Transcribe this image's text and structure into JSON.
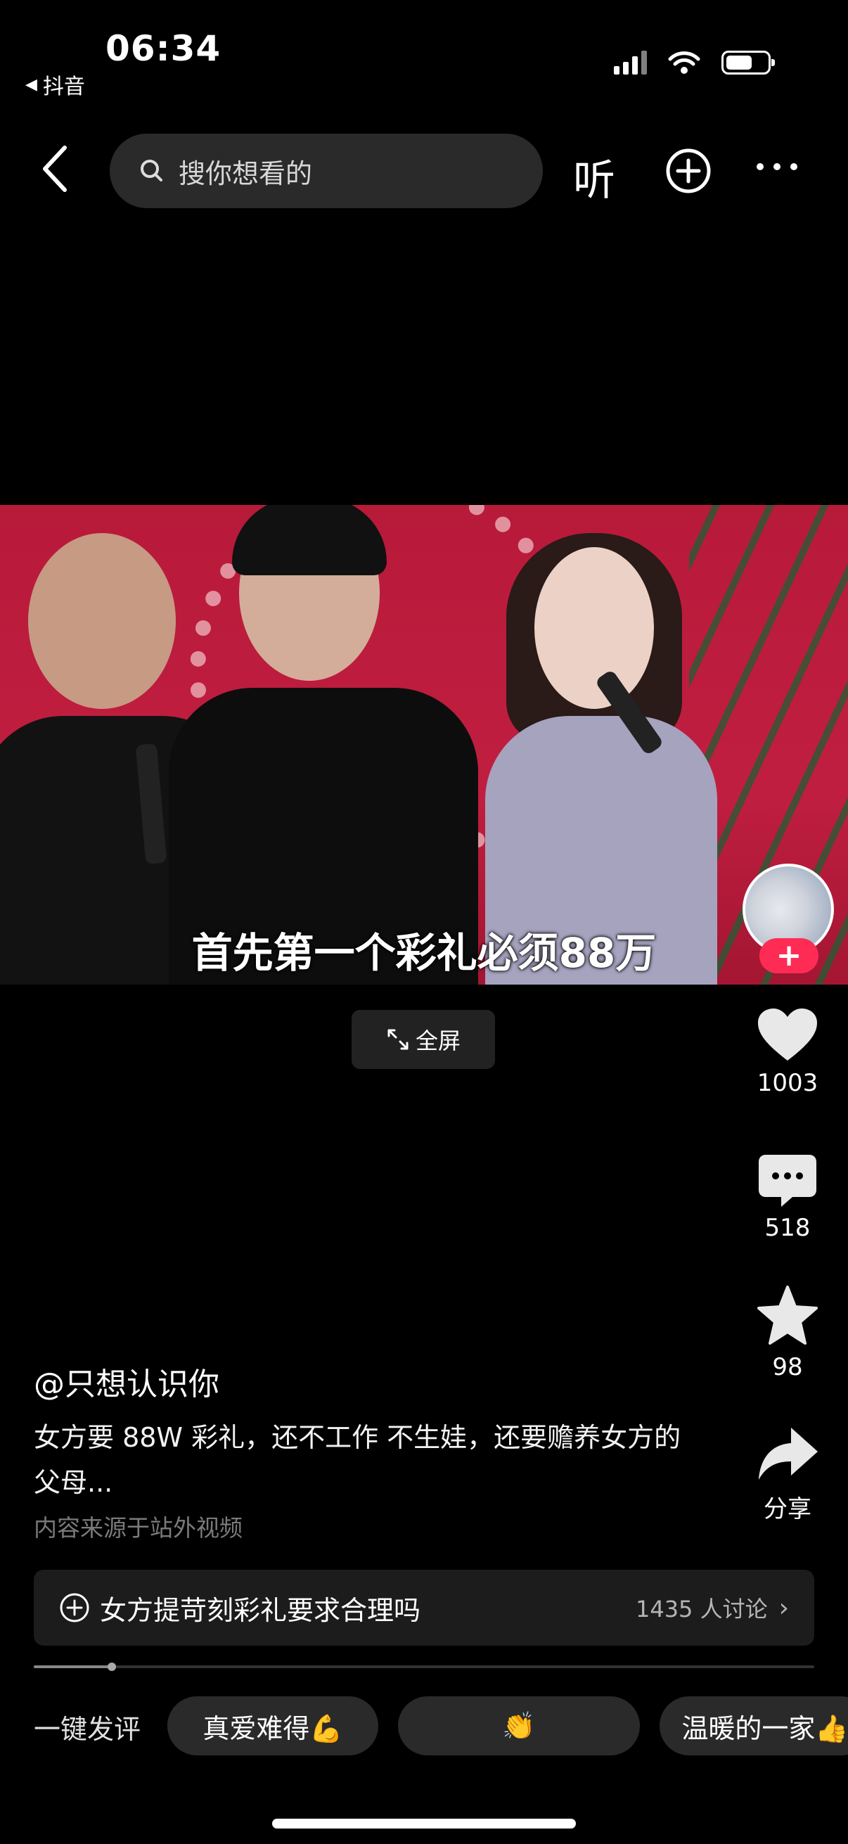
{
  "status_bar": {
    "time": "06:34",
    "back_app": "抖音"
  },
  "top_nav": {
    "search_placeholder": "搜你想看的",
    "listen_label": "听"
  },
  "video": {
    "subtitle": "首先第一个彩礼必须88万",
    "fullscreen_label": "全屏"
  },
  "actions": {
    "likes": "1003",
    "comments": "518",
    "favorites": "98",
    "share_label": "分享"
  },
  "caption": {
    "author": "@只想认识你",
    "description": "女方要 88W 彩礼，还不工作 不生娃，还要赡养女方的父母...",
    "source_note": "内容来源于站外视频"
  },
  "topic": {
    "title": "女方提苛刻彩礼要求合理吗",
    "participants": "1435 人讨论"
  },
  "quick_comment": {
    "label": "一键发评",
    "chips": [
      "真爱难得💪",
      "👏",
      "温暖的一家👍"
    ]
  },
  "progress": 0.1
}
